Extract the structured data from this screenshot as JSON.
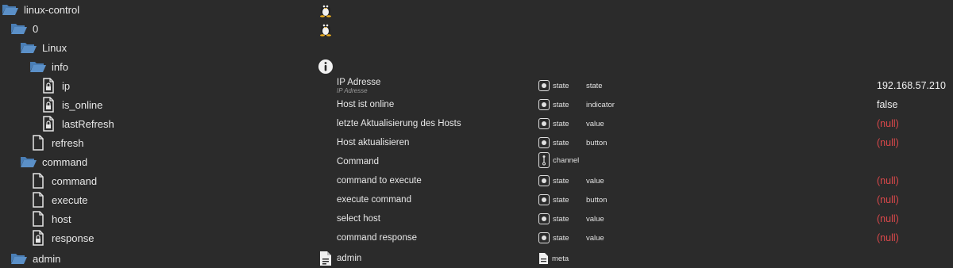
{
  "colors": {
    "folder": "#4a7eb5",
    "null_value": "#d9484a",
    "background": "#2b2b2b"
  },
  "rows": [
    {
      "label": "linux-control",
      "icon": "folder-open-icon",
      "list_icon": "linux-penguin-icon"
    },
    {
      "label": "0",
      "icon": "folder-open-icon",
      "list_icon": "linux-penguin-icon"
    },
    {
      "label": "Linux",
      "icon": "folder-open-icon"
    },
    {
      "label": "info",
      "icon": "folder-open-icon",
      "list_icon": "info-circle-icon"
    },
    {
      "label": "ip",
      "icon": "file-lock-icon",
      "name": "IP Adresse",
      "name_sub": "IP Adresse",
      "type": "state",
      "role": "state",
      "value": "192.168.57.210"
    },
    {
      "label": "is_online",
      "icon": "file-lock-icon",
      "name": "Host ist online",
      "type": "state",
      "role": "indicator",
      "value": "false"
    },
    {
      "label": "lastRefresh",
      "icon": "file-lock-icon",
      "name": "letzte Aktualisierung des Hosts",
      "type": "state",
      "role": "value",
      "value": "(null)"
    },
    {
      "label": "refresh",
      "icon": "file-icon",
      "name": "Host aktualisieren",
      "type": "state",
      "role": "button",
      "value": "(null)"
    },
    {
      "label": "command",
      "icon": "folder-open-icon",
      "name": "Command",
      "type": "channel"
    },
    {
      "label": "command",
      "icon": "file-icon",
      "name": "command to execute",
      "type": "state",
      "role": "value",
      "value": "(null)"
    },
    {
      "label": "execute",
      "icon": "file-icon",
      "name": "execute command",
      "type": "state",
      "role": "button",
      "value": "(null)"
    },
    {
      "label": "host",
      "icon": "file-icon",
      "name": "select host",
      "type": "state",
      "role": "value",
      "value": "(null)"
    },
    {
      "label": "response",
      "icon": "file-lock-icon",
      "name": "command response",
      "type": "state",
      "role": "value",
      "value": "(null)"
    },
    {
      "label": "admin",
      "icon": "folder-open-icon",
      "list_icon": "document-icon",
      "name": "admin",
      "type": "meta"
    }
  ]
}
